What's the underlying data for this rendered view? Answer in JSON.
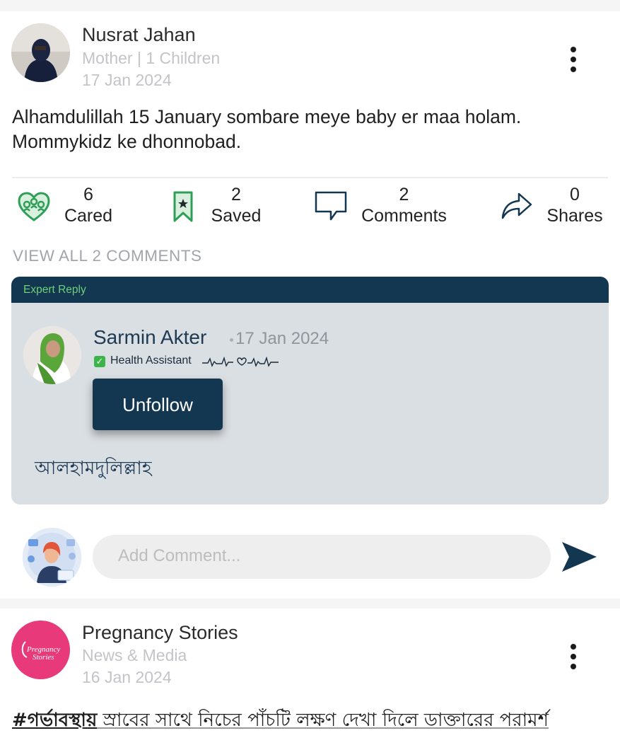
{
  "post1": {
    "author": "Nusrat Jahan",
    "subtitle": "Mother | 1 Children",
    "date": "17 Jan 2024",
    "text_line1": "Alhamdulillah 15 January sombare meye baby er maa holam.",
    "text_line2": "Mommykidz ke dhonnobad.",
    "actions": [
      {
        "count": "6",
        "label": "Cared",
        "icon": "heart-group-icon"
      },
      {
        "count": "2",
        "label": "Saved",
        "icon": "bookmark-icon"
      },
      {
        "count": "2",
        "label": "Comments",
        "icon": "comment-icon"
      },
      {
        "count": "0",
        "label": "Shares",
        "icon": "share-icon"
      }
    ],
    "view_all": "VIEW ALL 2 COMMENTS",
    "expert": {
      "header": "Expert Reply",
      "name": "Sarmin Akter",
      "date": "17 Jan 2024",
      "role": "Health Assistant",
      "unfollow_label": "Unfollow",
      "reply": "আলহামদুলিল্লাহ"
    },
    "comment_placeholder": "Add Comment..."
  },
  "post2": {
    "author": "Pregnancy Stories",
    "subtitle": "News & Media",
    "date": "16 Jan 2024",
    "logo_text_1": "Pregnancy",
    "logo_text_2": "Stories",
    "hashtag": "#গর্ভাবস্থায়",
    "text": " স্রাবের সাথে নিচের পাঁচটি লক্ষণ দেখা দিলে ডাক্তারের পরামর্শ"
  },
  "colors": {
    "brand_navy": "#133651",
    "expert_bg": "#dadfe3",
    "accent_green": "#2f9e57",
    "pink": "#e8397a"
  }
}
